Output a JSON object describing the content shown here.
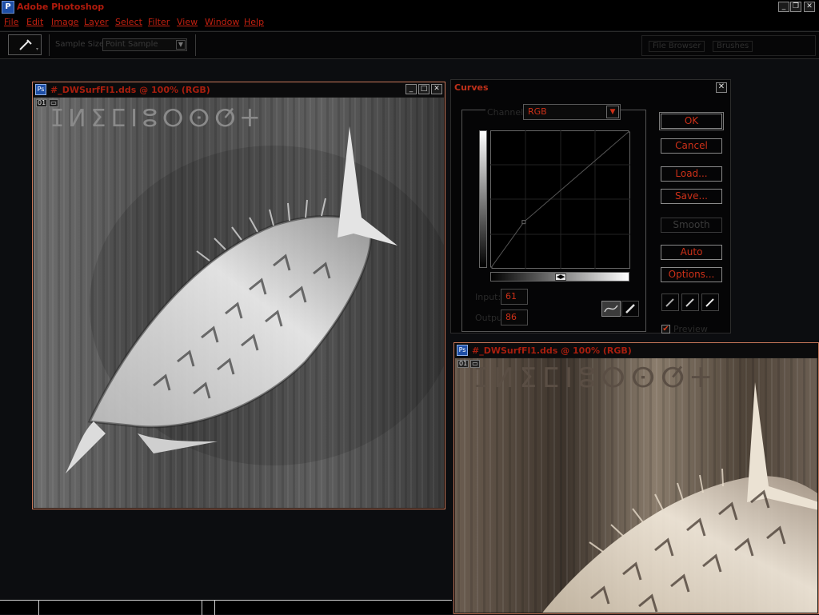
{
  "app": {
    "title": "Adobe Photoshop"
  },
  "menu": [
    "File",
    "Edit",
    "Image",
    "Layer",
    "Select",
    "Filter",
    "View",
    "Window",
    "Help"
  ],
  "options_bar": {
    "sample_size_label": "Sample Size:",
    "sample_size_value": "Point Sample",
    "palette_tabs": [
      "File Browser",
      "Brushes"
    ]
  },
  "documents": [
    {
      "title": "#_DWSurfFl1.dds @ 100% (RGB)",
      "channel_badge": "01",
      "canvas_text": "ⵊⵍⵉⵎⵏⵓⵔⵙⵚⵜ",
      "tone": "grayscale",
      "active": false
    },
    {
      "title": "#_DWSurfFl1.dds @ 100% (RGB)",
      "channel_badge": "01",
      "canvas_text": "ⵊⵍⵉⵎⵏⵓⵔⵙⵚⵜ",
      "tone": "sepia",
      "active": true
    }
  ],
  "curves": {
    "title": "Curves",
    "channel_label": "Channel:",
    "channel_value": "RGB",
    "input_label": "Input:",
    "input_value": "61",
    "output_label": "Output:",
    "output_value": "86",
    "curve_points": [
      [
        0,
        0
      ],
      [
        61,
        86
      ],
      [
        255,
        255
      ]
    ],
    "buttons": {
      "ok": "OK",
      "cancel": "Cancel",
      "load": "Load...",
      "save": "Save...",
      "smooth": "Smooth",
      "auto": "Auto",
      "options": "Options..."
    },
    "preview_label": "Preview",
    "preview_checked": true
  },
  "status_bar": {
    "zoom": "",
    "info": ""
  },
  "colors": {
    "menu_text": "#c22010",
    "accent_border": "#c8785a",
    "dialog_text": "#cc3018"
  }
}
